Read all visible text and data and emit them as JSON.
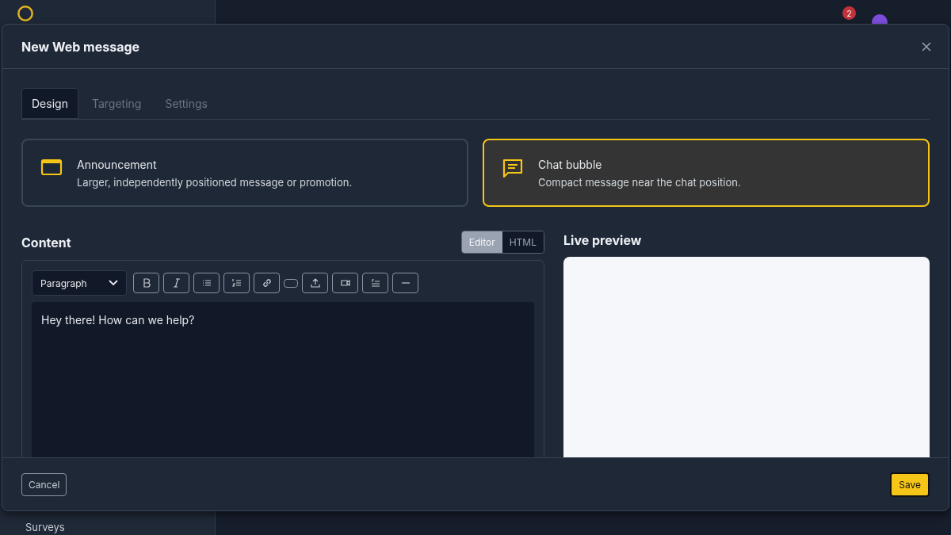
{
  "background": {
    "notification_count": "2",
    "sidebar_items": [
      "Surveys"
    ]
  },
  "dialog": {
    "title": "New Web message",
    "tabs": [
      {
        "label": "Design",
        "selected": true
      },
      {
        "label": "Targeting",
        "selected": false
      },
      {
        "label": "Settings",
        "selected": false
      }
    ],
    "message_types": [
      {
        "kind": "announcement",
        "title": "Announcement",
        "description": "Larger, independently positioned message or promotion.",
        "selected": false
      },
      {
        "kind": "chat",
        "title": "Chat bubble",
        "description": "Compact message near the chat position.",
        "selected": true
      }
    ],
    "content": {
      "heading": "Content",
      "modes": [
        {
          "label": "Editor",
          "selected": true
        },
        {
          "label": "HTML",
          "selected": false
        }
      ],
      "block_format": "Paragraph",
      "toolbar": [
        {
          "kind": "bold"
        },
        {
          "kind": "italic"
        },
        {
          "kind": "bullets"
        },
        {
          "kind": "numbers"
        },
        {
          "kind": "link"
        },
        {
          "kind": "pill"
        },
        {
          "kind": "upload"
        },
        {
          "kind": "video"
        },
        {
          "kind": "quote"
        },
        {
          "kind": "rule"
        }
      ],
      "text": "Hey there! How can we help?"
    },
    "preview": {
      "heading": "Live preview"
    },
    "buttons": {
      "cancel": "Cancel",
      "save": "Save"
    }
  }
}
